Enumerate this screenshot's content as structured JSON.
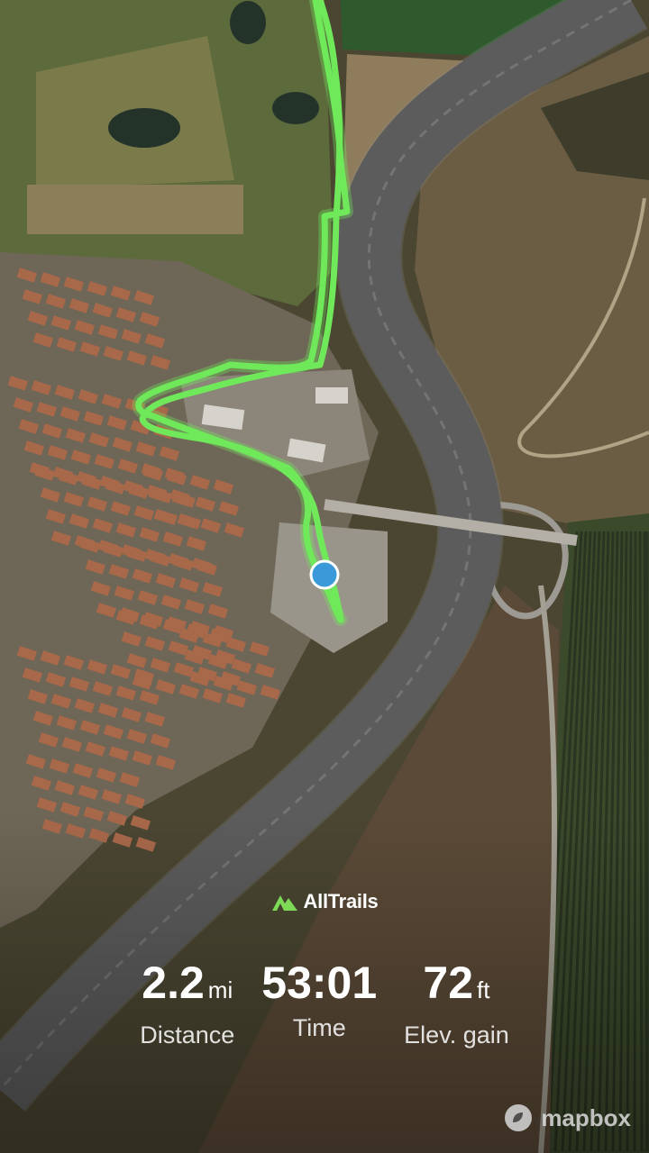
{
  "brand": {
    "name": "AllTrails",
    "logo_icon": "alltrails-mountain-icon",
    "accent": "#7ed957"
  },
  "stats": [
    {
      "value": "2.2",
      "unit": "mi",
      "label": "Distance"
    },
    {
      "value": "53:01",
      "unit": "",
      "label": "Time"
    },
    {
      "value": "72",
      "unit": "ft",
      "label": "Elev. gain"
    }
  ],
  "attribution": {
    "name": "mapbox",
    "icon": "mapbox-logo-icon"
  },
  "map": {
    "style": "satellite-3d",
    "track_color": "#6fe85a",
    "location_marker_color": "#3a9ad9"
  }
}
